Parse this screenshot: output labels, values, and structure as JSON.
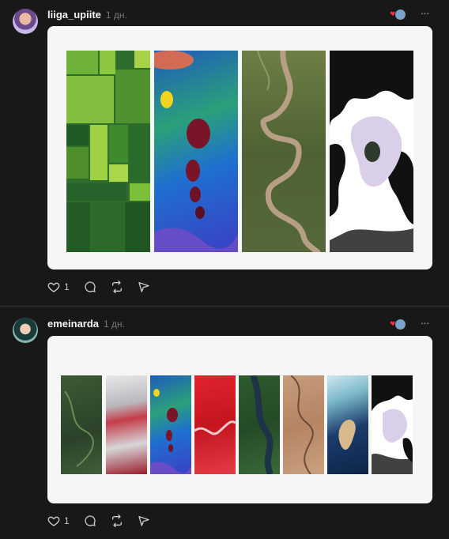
{
  "posts": [
    {
      "username": "liiga_upiite",
      "time": "1 дн.",
      "likes": "1",
      "image_panel_count": 4
    },
    {
      "username": "emeinarda",
      "time": "1 дн.",
      "likes": "1",
      "image_panel_count": 8
    }
  ],
  "icons": {
    "like": "heart-icon",
    "reply": "comment-icon",
    "repost": "repost-icon",
    "share": "send-icon",
    "more": "more-icon"
  },
  "colors": {
    "background": "#181818",
    "card": "#f6f6f6",
    "accent_heart": "#ff3040"
  }
}
